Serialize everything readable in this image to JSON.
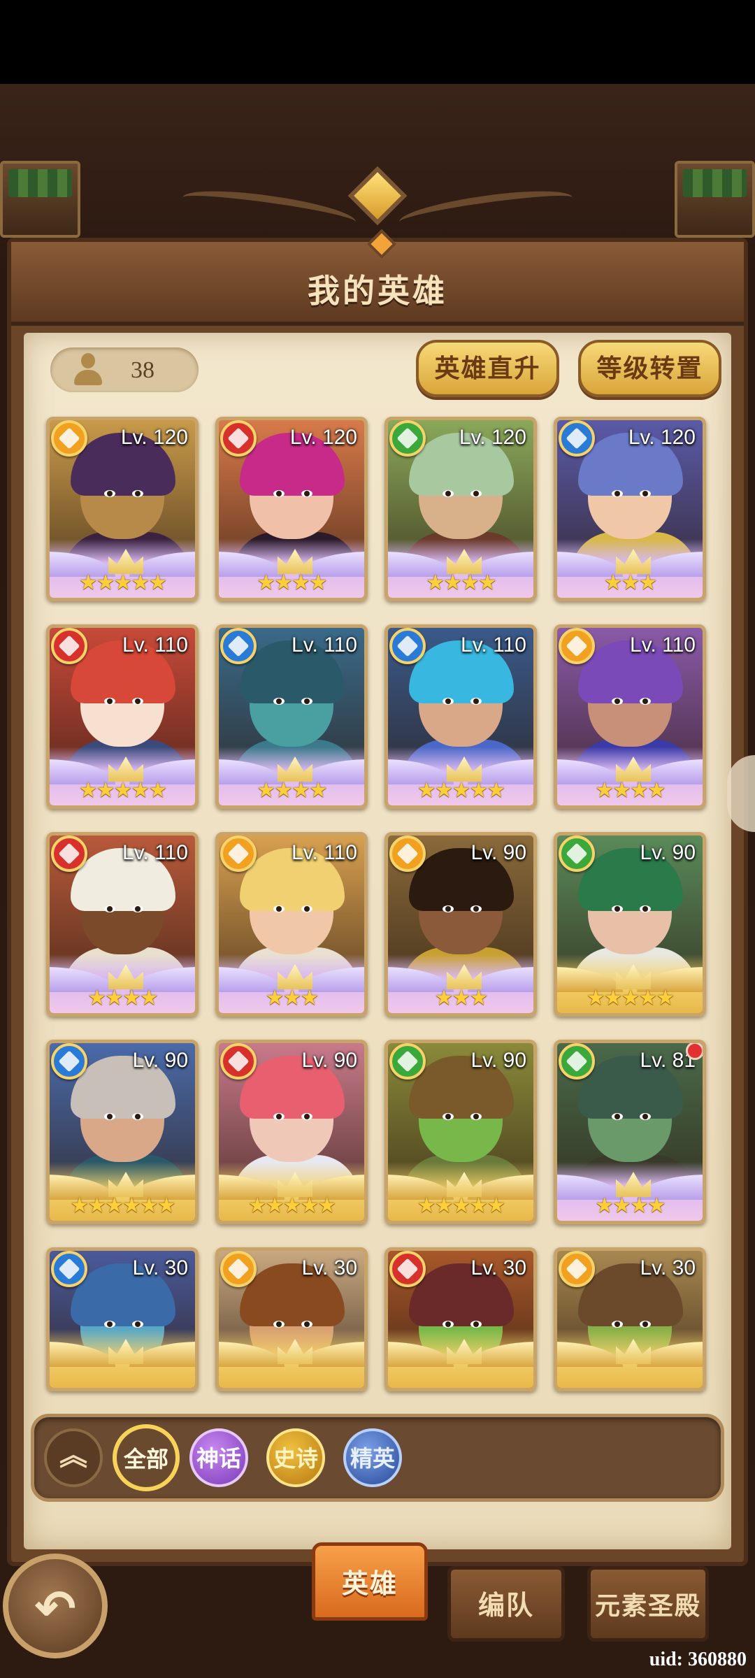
{
  "title": "我的英雄",
  "hero_count": "38",
  "buttons": {
    "upgrade": "英雄直升",
    "level_transfer": "等级转置"
  },
  "heroes": [
    {
      "level": "Lv. 120",
      "element": "light",
      "element_color": "#f2a020",
      "tier": "mythic",
      "stars": "★★★★★",
      "skin": "#b88a4a",
      "hair": "#4a2c5a",
      "torso": "#3a2240",
      "bg": "#c89a4a"
    },
    {
      "level": "Lv. 120",
      "element": "fire",
      "element_color": "#d8302a",
      "tier": "mythic",
      "stars": "★★★★",
      "skin": "#f0c0a8",
      "hair": "#c82a8a",
      "torso": "#2a1a2a",
      "bg": "#d87a4a"
    },
    {
      "level": "Lv. 120",
      "element": "nature",
      "element_color": "#3aa83a",
      "tier": "mythic",
      "stars": "★★★★",
      "skin": "#d8b08a",
      "hair": "#a8c8a0",
      "torso": "#6a3a2a",
      "bg": "#8aa85a"
    },
    {
      "level": "Lv. 120",
      "element": "water",
      "element_color": "#2a7ad8",
      "tier": "mythic",
      "stars": "★★★",
      "skin": "#f0c8a8",
      "hair": "#6a7ac8",
      "torso": "#d8b848",
      "bg": "#5a5aa8"
    },
    {
      "level": "Lv. 110",
      "element": "fire",
      "element_color": "#d8302a",
      "tier": "mythic",
      "stars": "★★★★★",
      "skin": "#f8e0d0",
      "hair": "#d84838",
      "torso": "#3a4a7a",
      "bg": "#c84a3a"
    },
    {
      "level": "Lv. 110",
      "element": "water",
      "element_color": "#2a7ad8",
      "tier": "mythic",
      "stars": "★★★★",
      "skin": "#4aa0a0",
      "hair": "#2a5a6a",
      "torso": "#3a7a8a",
      "bg": "#3a6a8a"
    },
    {
      "level": "Lv. 110",
      "element": "water",
      "element_color": "#2a7ad8",
      "tier": "mythic",
      "stars": "★★★★★",
      "skin": "#d8a888",
      "hair": "#38b8e0",
      "torso": "#4a68c8",
      "bg": "#3a5a8a"
    },
    {
      "level": "Lv. 110",
      "element": "light",
      "element_color": "#f2a020",
      "tier": "mythic",
      "stars": "★★★★",
      "skin": "#c89078",
      "hair": "#7a4ab8",
      "torso": "#3a3aa8",
      "bg": "#8a5aa8"
    },
    {
      "level": "Lv. 110",
      "element": "fire",
      "element_color": "#d8302a",
      "tier": "mythic",
      "stars": "★★★★",
      "skin": "#7a4a2a",
      "hair": "#f0ece0",
      "torso": "#e8e0cc",
      "bg": "#b85a3a"
    },
    {
      "level": "Lv. 110",
      "element": "light",
      "element_color": "#f2a020",
      "tier": "mythic",
      "stars": "★★★",
      "skin": "#f0c8a8",
      "hair": "#f0d070",
      "torso": "#e8e0d0",
      "bg": "#d8a050"
    },
    {
      "level": "Lv. 90",
      "element": "light",
      "element_color": "#f2a020",
      "tier": "mythic",
      "stars": "★★★",
      "skin": "#8a5a3a",
      "hair": "#2a1a10",
      "torso": "#c8a030",
      "bg": "#8a6a3a"
    },
    {
      "level": "Lv. 90",
      "element": "nature",
      "element_color": "#3aa83a",
      "tier": "epic",
      "stars": "★★★★★",
      "skin": "#e8c0a8",
      "hair": "#2a7a4a",
      "torso": "#e8e8e0",
      "bg": "#5a8a5a"
    },
    {
      "level": "Lv. 90",
      "element": "water",
      "element_color": "#2a7ad8",
      "tier": "epic",
      "stars": "★★★★★★",
      "skin": "#d8a888",
      "hair": "#c8c0b8",
      "torso": "#2a5a6a",
      "bg": "#4a6aa8"
    },
    {
      "level": "Lv. 90",
      "element": "fire",
      "element_color": "#d8302a",
      "tier": "epic",
      "stars": "★★★★★",
      "skin": "#f0c8b8",
      "hair": "#e86070",
      "torso": "#e8e8f0",
      "bg": "#c87a8a"
    },
    {
      "level": "Lv. 90",
      "element": "nature",
      "element_color": "#3aa83a",
      "tier": "epic",
      "stars": "★★★★★",
      "skin": "#78b84a",
      "hair": "#7a5a2a",
      "torso": "#6a7a3a",
      "bg": "#8a8a3a"
    },
    {
      "level": "Lv. 81",
      "element": "nature",
      "element_color": "#3aa83a",
      "tier": "mythic",
      "stars": "★★★★",
      "skin": "#6a9a6a",
      "hair": "#3a5a4a",
      "torso": "#3a3a2a",
      "bg": "#4a6a4a",
      "notify": true
    },
    {
      "level": "Lv. 30",
      "element": "water",
      "element_color": "#2a7ad8",
      "tier": "epic",
      "stars": "",
      "skin": "#58a8c8",
      "hair": "#3a6aa8",
      "torso": "#8a4a3a",
      "bg": "#4a5a9a"
    },
    {
      "level": "Lv. 30",
      "element": "light",
      "element_color": "#f2a020",
      "tier": "epic",
      "stars": "",
      "skin": "#d8a070",
      "hair": "#8a4a20",
      "torso": "#e8e8e0",
      "bg": "#c8a880"
    },
    {
      "level": "Lv. 30",
      "element": "fire",
      "element_color": "#d8302a",
      "tier": "epic",
      "stars": "",
      "skin": "#78b848",
      "hair": "#6a2a2a",
      "torso": "#e8d8c8",
      "bg": "#a8582a"
    },
    {
      "level": "Lv. 30",
      "element": "light",
      "element_color": "#f2a020",
      "tier": "epic",
      "stars": "",
      "skin": "#88b048",
      "hair": "#6a4a2a",
      "torso": "#e8d8c8",
      "bg": "#a88850"
    }
  ],
  "filters": {
    "collapse": "︽",
    "all": "全部",
    "mythic": "神话",
    "epic": "史诗",
    "elite": "精英"
  },
  "tabs": {
    "hero": "英雄",
    "team": "编队",
    "temple": "元素圣殿"
  },
  "back_icon": "↶",
  "uid": "uid: 360880"
}
